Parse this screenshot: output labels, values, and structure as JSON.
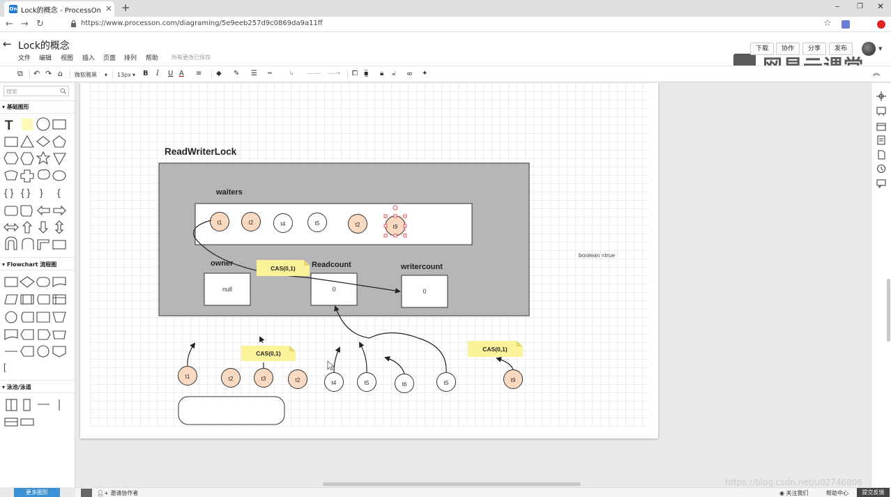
{
  "browser": {
    "tab_title": "Lock的概念 - ProcessOn",
    "favicon_text": "On",
    "url": "https://www.processon.com/diagraming/5e9eeb257d9c0869da9a11ff"
  },
  "app": {
    "doc_title": "Lock的概念",
    "menu": [
      "文件",
      "编辑",
      "视图",
      "插入",
      "页面",
      "排列",
      "帮助"
    ],
    "save_status": "所有更改已保存",
    "header_buttons": [
      "下载",
      "协作",
      "分享",
      "发布"
    ],
    "watermark": "网易云课堂"
  },
  "toolbar": {
    "font_family": "微软雅黑",
    "font_size": "13px"
  },
  "sidebar": {
    "search_placeholder": "搜索",
    "categories": [
      "基础图形",
      "Flowchart 流程图",
      "泳池/泳道"
    ],
    "more_shapes": "更多图形"
  },
  "diagram": {
    "title": "ReadWriterLock",
    "waiters_label": "waiters",
    "owner_label": "owner",
    "owner_value": "null",
    "readcount_label": "Readcount",
    "readcount_value": "0",
    "writercount_label": "writercount",
    "writercount_value": "0",
    "boolean_note": "boolean =true",
    "cas_label": "CAS(0,1)",
    "waiters": [
      "t1",
      "t2",
      "t4",
      "t5",
      "t2",
      "t9"
    ],
    "threads": [
      "t1",
      "t2",
      "t3",
      "t2",
      "t4",
      "t5",
      "t6",
      "t5",
      "t9"
    ]
  },
  "footer": {
    "invite": "邀请协作者",
    "follow": "关注我们",
    "help": "帮助中心",
    "feedback": "提交反馈",
    "csdn": "https://blog.csdn.net/u02746806"
  },
  "colors": {
    "thread_fill": "#fad9c1",
    "sticky": "#fbf39a",
    "lock_box": "#b6b6b6",
    "accent": "#3b91d3"
  }
}
